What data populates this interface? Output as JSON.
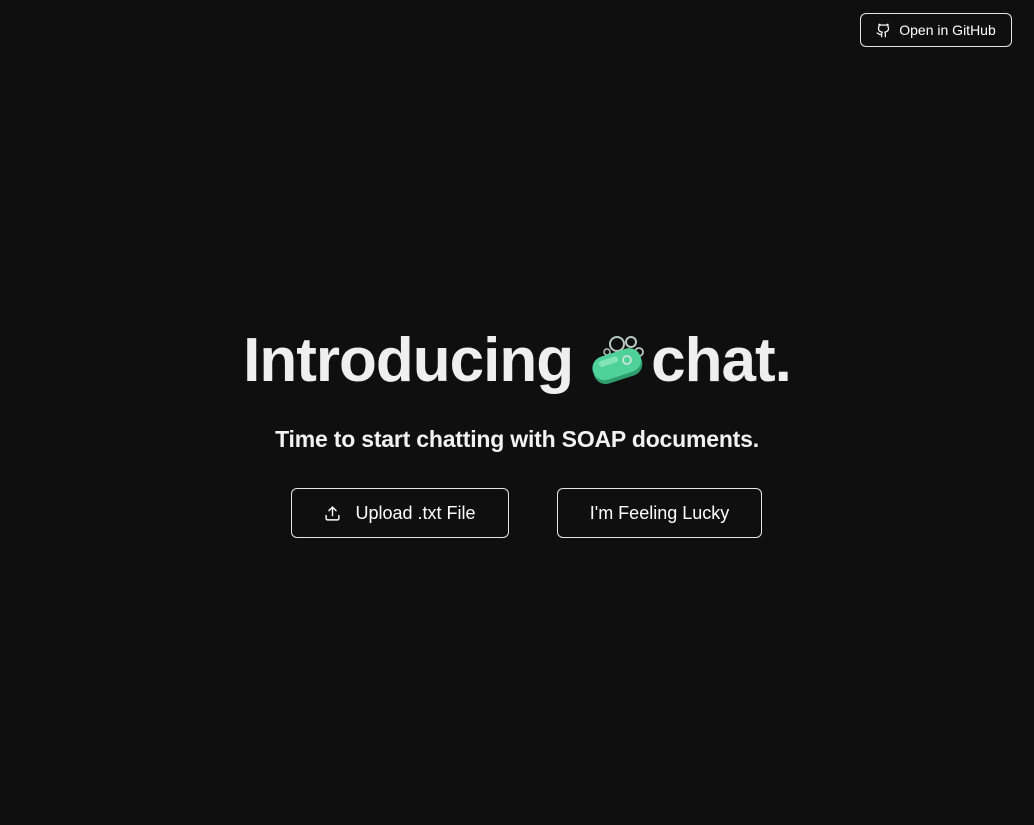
{
  "header": {
    "github_button": {
      "label": "Open in GitHub",
      "icon": "github-icon"
    }
  },
  "hero": {
    "headline_prefix": "Introducing",
    "headline_icon": "soap-icon",
    "headline_suffix": "chat.",
    "subheadline": "Time to start chatting with SOAP documents."
  },
  "actions": {
    "upload": {
      "label": "Upload .txt File",
      "icon": "upload-icon"
    },
    "lucky": {
      "label": "I'm Feeling Lucky"
    }
  },
  "colors": {
    "background": "#0f0f0f",
    "text": "#f2f2f2",
    "border": "#e6e6e6",
    "soap_green": "#4fd19a"
  }
}
